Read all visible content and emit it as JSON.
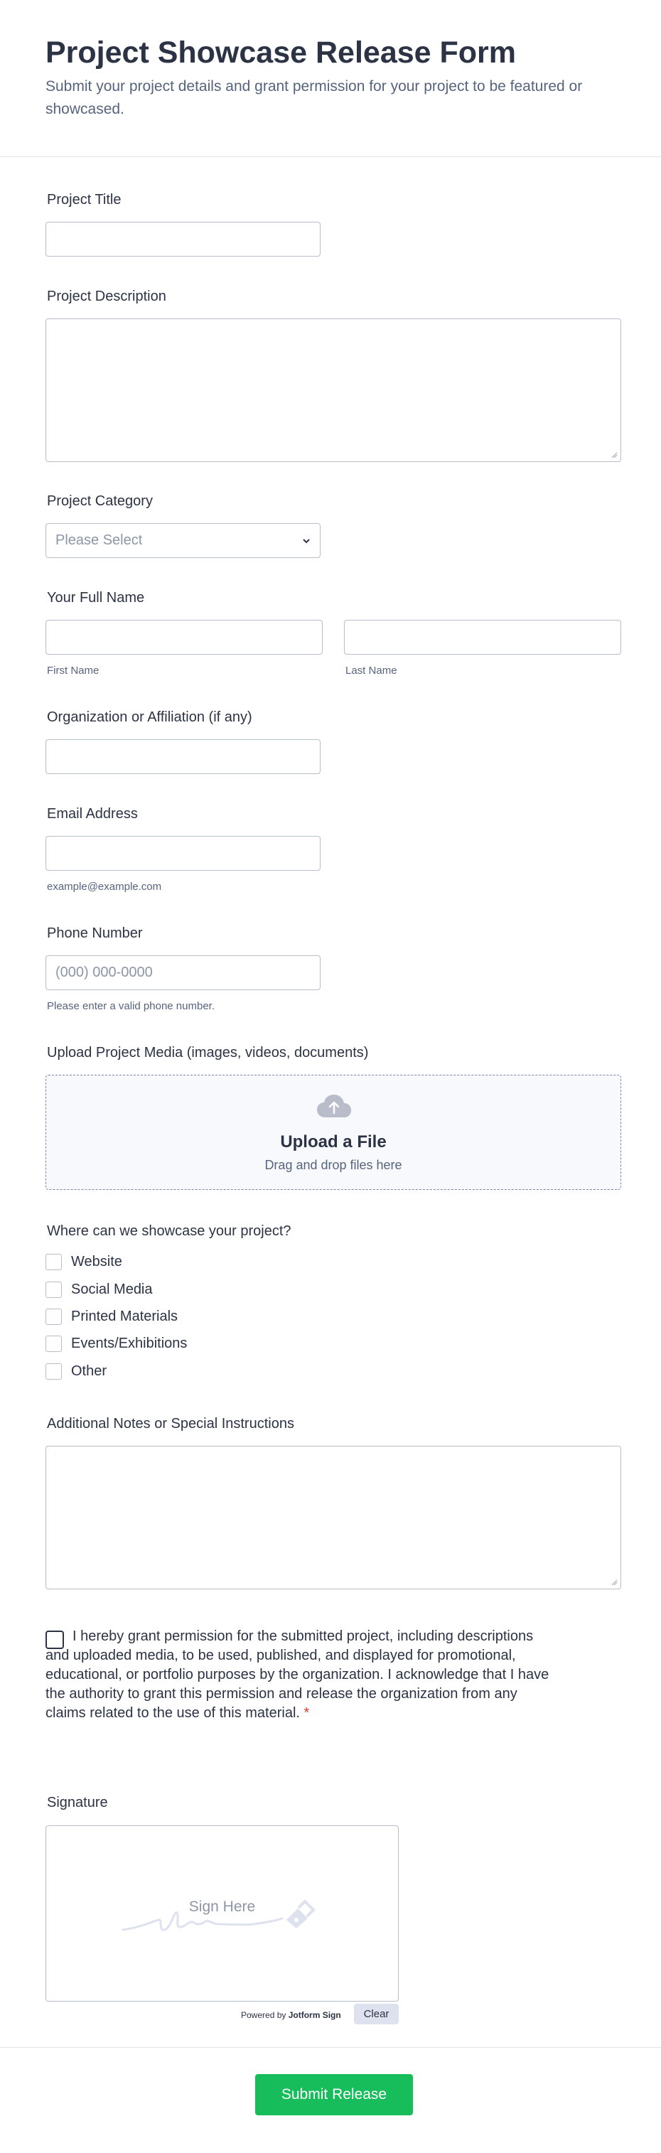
{
  "header": {
    "title": "Project Showcase Release Form",
    "subtitle": "Submit your project details and grant permission for your project to be featured or showcased."
  },
  "fields": {
    "project_title": {
      "label": "Project Title",
      "value": ""
    },
    "project_description": {
      "label": "Project Description",
      "value": ""
    },
    "project_category": {
      "label": "Project Category",
      "placeholder": "Please Select"
    },
    "full_name": {
      "label": "Your Full Name",
      "first_sublabel": "First Name",
      "last_sublabel": "Last Name"
    },
    "organization": {
      "label": "Organization or Affiliation (if any)",
      "value": ""
    },
    "email": {
      "label": "Email Address",
      "sublabel": "example@example.com"
    },
    "phone": {
      "label": "Phone Number",
      "placeholder": "(000) 000-0000",
      "sublabel": "Please enter a valid phone number."
    },
    "upload": {
      "label": "Upload Project Media (images, videos, documents)",
      "title": "Upload a File",
      "subtitle": "Drag and drop files here"
    },
    "showcase": {
      "label": "Where can we showcase your project?",
      "options": [
        "Website",
        "Social Media",
        "Printed Materials",
        "Events/Exhibitions",
        "Other"
      ]
    },
    "notes": {
      "label": "Additional Notes or Special Instructions",
      "value": ""
    },
    "consent": {
      "text": "I hereby grant permission for the submitted project, including descriptions and uploaded media, to be used, published, and displayed for promotional, educational, or portfolio purposes by the organization. I acknowledge that I have the authority to grant this permission and release the organization from any claims related to the use of this material.",
      "required_mark": "*"
    },
    "signature": {
      "label": "Signature",
      "placeholder": "Sign Here",
      "powered_by": "Powered by",
      "brand": "Jotform Sign",
      "clear_label": "Clear"
    }
  },
  "submit": {
    "label": "Submit Release"
  },
  "colors": {
    "submit": "#18bd5b",
    "text": "#2c3345",
    "required": "#e13e2b"
  }
}
